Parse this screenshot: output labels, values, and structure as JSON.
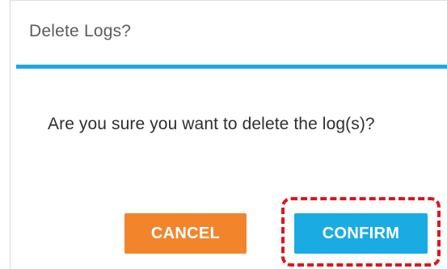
{
  "dialog": {
    "title": "Delete Logs?",
    "message": "Are you sure you want to delete the log(s)?",
    "cancel_label": "CANCEL",
    "confirm_label": "CONFIRM"
  },
  "colors": {
    "title_rule": "#1ea7e1",
    "cancel_button": "#f2852b",
    "confirm_button": "#1aabe3",
    "highlight": "#e0141e"
  }
}
